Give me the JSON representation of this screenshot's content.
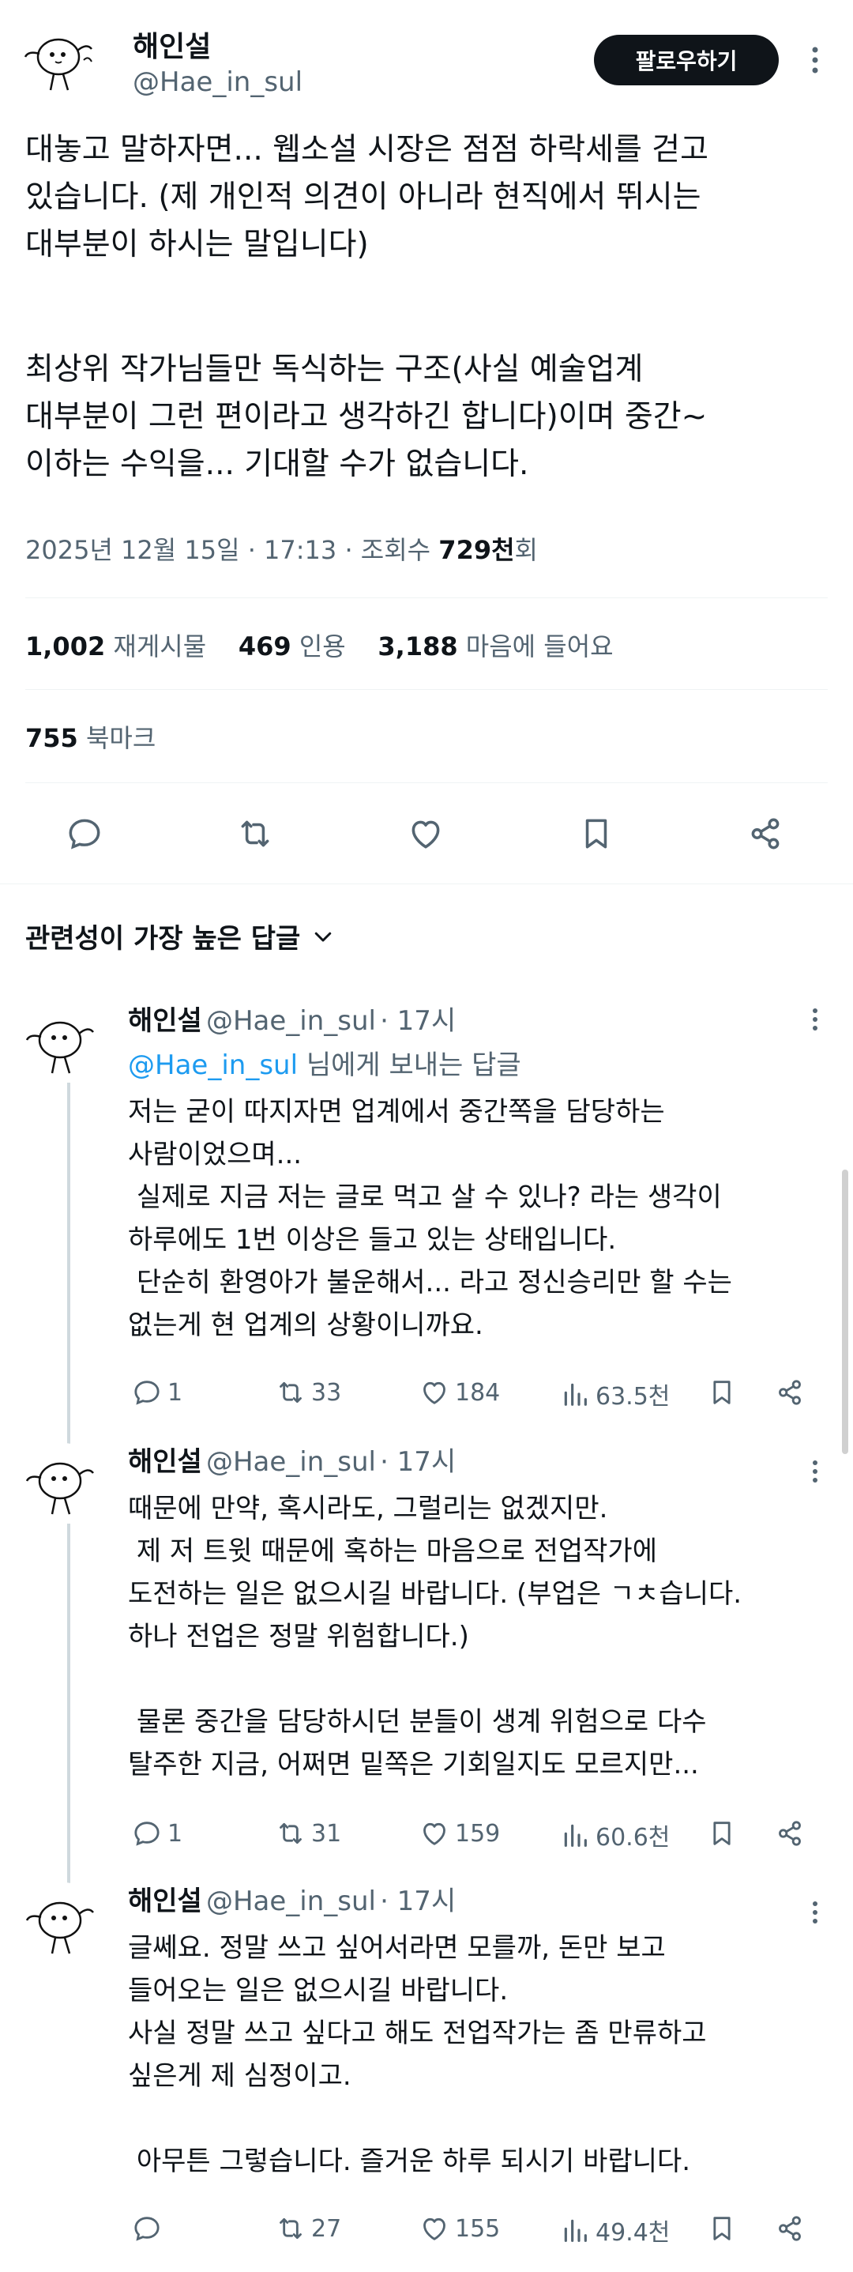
{
  "author": {
    "name": "해인설",
    "handle": "@Hae_in_sul",
    "follow_label": "팔로우하기"
  },
  "post": {
    "paragraph1": "대놓고 말하자면... 웹소설 시장은 점점 하락세를 걷고\n있습니다. (제 개인적 의견이 아니라 현직에서 뛰시는\n대부분이 하시는 말입니다)",
    "paragraph2": "최상위 작가님들만 독식하는 구조(사실 예술업계\n대부분이 그런 편이라고 생각하긴 합니다)이며 중간~\n이하는 수익을... 기대할 수가 없습니다.",
    "date": "2025년 12월 15일 · 17:13",
    "views_label": "· 조회수",
    "views_value": "729천",
    "views_suffix": "회"
  },
  "stats": {
    "reposts_count": "1,002",
    "reposts_label": "재게시물",
    "quotes_count": "469",
    "quotes_label": "인용",
    "likes_count": "3,188",
    "likes_label": "마음에 들어요",
    "bookmarks_count": "755",
    "bookmarks_label": "북마크"
  },
  "sort": {
    "label": "관련성이 가장 높은 답글"
  },
  "replies": [
    {
      "name": "해인설",
      "handle": "@Hae_in_sul",
      "time": "· 17시",
      "reply_to_handle": "@Hae_in_sul",
      "reply_to_suffix": "님에게 보내는 답글",
      "text": "저는 굳이 따지자면 업계에서 중간쪽을 담당하는\n사람이었으며...\n 실제로 지금 저는 글로 먹고 살 수 있나? 라는 생각이\n하루에도 1번 이상은 들고 있는 상태입니다.\n 단순히 환영아가 불운해서... 라고 정신승리만 할 수는\n없는게 현 업계의 상황이니까요.",
      "replies": "1",
      "reposts": "33",
      "likes": "184",
      "views": "63.5천"
    },
    {
      "name": "해인설",
      "handle": "@Hae_in_sul",
      "time": "· 17시",
      "text": "때문에 만약, 혹시라도, 그럴리는 없겠지만.\n 제 저 트윗 때문에 혹하는 마음으로 전업작가에\n도전하는 일은 없으시길 바랍니다. (부업은 ㄱㅊ습니다.\n하나 전업은 정말 위험합니다.)\n\n 물론 중간을 담당하시던 분들이 생계 위험으로 다수\n탈주한 지금, 어쩌면 밑쪽은 기회일지도 모르지만...",
      "replies": "1",
      "reposts": "31",
      "likes": "159",
      "views": "60.6천"
    },
    {
      "name": "해인설",
      "handle": "@Hae_in_sul",
      "time": "· 17시",
      "text": "글쎄요. 정말 쓰고 싶어서라면 모를까, 돈만 보고\n들어오는 일은 없으시길 바랍니다.\n사실 정말 쓰고 싶다고 해도 전업작가는 좀 만류하고\n싶은게 제 심정이고.\n\n 아무튼 그렇습니다. 즐거운 하루 되시기 바랍니다.",
      "replies": "",
      "reposts": "27",
      "likes": "155",
      "views": "49.4천"
    }
  ],
  "colors": {
    "text": "#0f1419",
    "muted": "#536471",
    "link": "#1d9bf0",
    "divider": "#eff3f4",
    "button_bg": "#0f1419"
  }
}
